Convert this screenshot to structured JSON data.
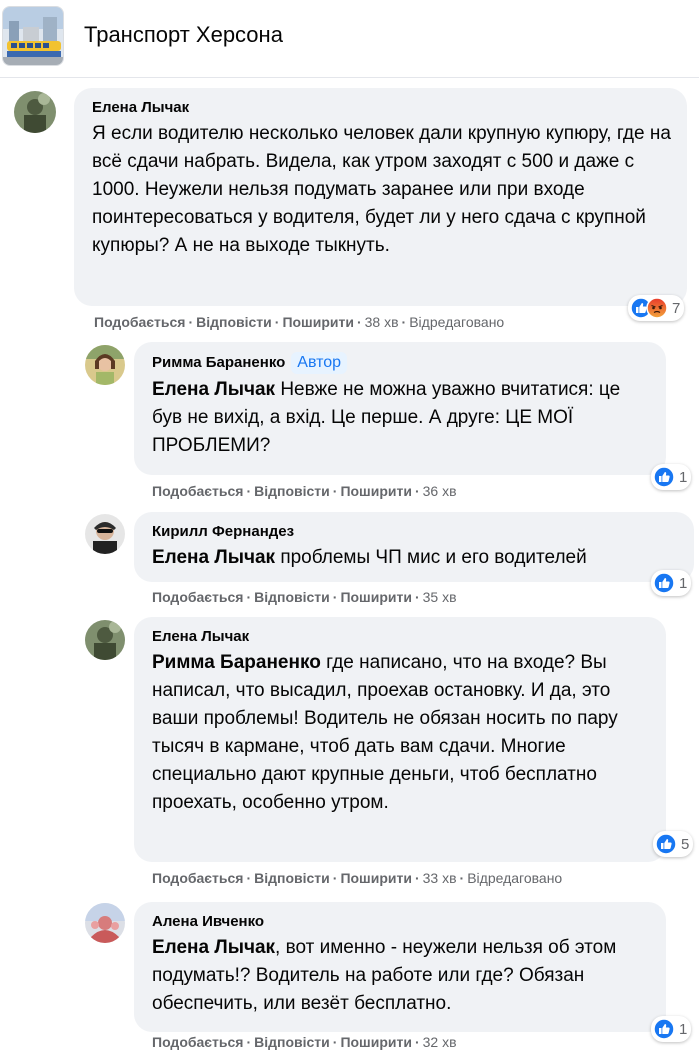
{
  "header": {
    "title": "Транспорт Херсона"
  },
  "colors": {
    "accent": "#1877f2",
    "bubble": "#f0f2f5",
    "meta": "#65676b",
    "angry": "#e9710f"
  },
  "actions": {
    "like": "Подобається",
    "reply": "Відповісти",
    "share": "Поширити",
    "edited": "Відредаговано"
  },
  "comments": [
    {
      "author": "Елена Лычак",
      "text": "Я если водителю несколько человек дали крупную купюру, где на всё сдачи набрать. Видела, как утром заходят с 500 и даже с 1000. Неужели нельзя подумать заранее или при входе поинтересоваться у водителя, будет ли у него сдача с крупной купюры? А не на выходе тыкнуть.",
      "time": "38 хв",
      "reactions": [
        "like-icon",
        "angry-icon"
      ],
      "reaction_count": "7"
    },
    {
      "author": "Римма Бараненко",
      "badge": "Автор",
      "mention": "Елена Лычак",
      "text": " Невже не можна уважно вчитатися: це був не вихід, а вхід. Це перше. А друге: ЦЕ МОЇ ПРОБЛЕМИ?",
      "time": "36 хв",
      "reactions": [
        "like-icon"
      ],
      "reaction_count": "1"
    },
    {
      "author": "Кирилл Фернандез",
      "mention": "Елена Лычак",
      "text": " проблемы ЧП мис и его водителей",
      "time": "35 хв",
      "reactions": [
        "like-icon"
      ],
      "reaction_count": "1"
    },
    {
      "author": "Елена Лычак",
      "mention": "Римма Бараненко",
      "text": " где написано, что на входе? Вы написал, что высадил, проехав остановку. И да, это ваши проблемы! Водитель не обязан носить по пару тысяч в кармане, чтоб дать вам сдачи. Многие специально дают крупные деньги, чтоб бесплатно проехать, особенно утром.",
      "time": "33 хв",
      "reactions": [
        "like-icon"
      ],
      "reaction_count": "5"
    },
    {
      "author": "Алена Ивченко",
      "mention": "Елена Лычак",
      "text": ", вот именно - неужели нельзя об этом подумать!? Водитель на работе или где? Обязан обеспечить, или везёт бесплатно.",
      "time": "32 хв",
      "reactions": [
        "like-icon"
      ],
      "reaction_count": "1"
    }
  ]
}
